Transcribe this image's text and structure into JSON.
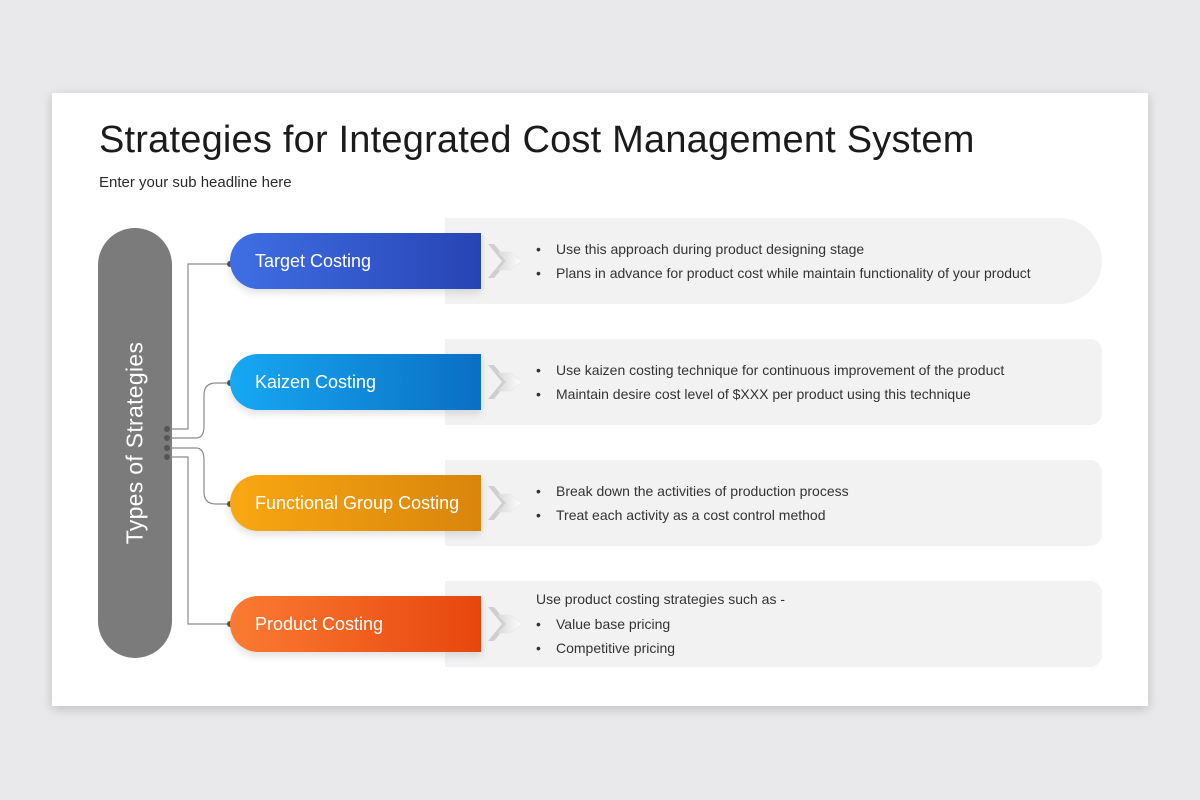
{
  "title": "Strategies for Integrated Cost Management System",
  "subtitle": "Enter your sub headline here",
  "pillar_label": "Types of Strategies",
  "bullet_glyph": "•",
  "strategies": [
    {
      "name": "Target Costing",
      "color": "#2f55cc",
      "lines": [
        {
          "bullet": true,
          "text": "Use this approach during product designing stage"
        },
        {
          "bullet": true,
          "text": "Plans in advance for product cost while maintain functionality of your product"
        }
      ]
    },
    {
      "name": "Kaizen Costing",
      "color": "#0e8cdc",
      "lines": [
        {
          "bullet": true,
          "text": "Use kaizen costing technique for continuous improvement of the product"
        },
        {
          "bullet": true,
          "text": "Maintain desire cost level of $XXX per product using this technique"
        }
      ]
    },
    {
      "name": "Functional Group Costing",
      "color": "#f09a10",
      "lines": [
        {
          "bullet": true,
          "text": "Break down the activities of production process"
        },
        {
          "bullet": true,
          "text": "Treat each activity as a cost control method"
        }
      ]
    },
    {
      "name": "Product Costing",
      "color": "#f05a1e",
      "lines": [
        {
          "bullet": false,
          "text": "Use product costing strategies such as -"
        },
        {
          "bullet": true,
          "text": "Value base pricing"
        },
        {
          "bullet": true,
          "text": "Competitive pricing"
        }
      ]
    }
  ]
}
